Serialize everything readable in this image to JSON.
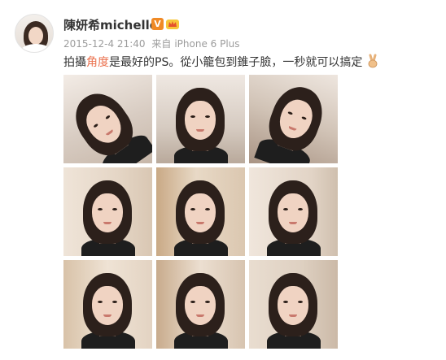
{
  "post": {
    "user_name": "陳妍希michelle",
    "verified_badge": "V",
    "member_badge_icon": "crown-member-icon",
    "timestamp": "2015-12-4 21:40",
    "source_prefix": "来自",
    "source_device": "iPhone 6 Plus",
    "text_before": "拍攝",
    "text_highlight": "角度",
    "text_after": "是最好的PS。從小籠包到錐子臉，一秒就可以搞定",
    "emoji_icon": "victory-hand-icon",
    "highlight_color": "#eb7350",
    "verified_color": "#f08a26"
  },
  "photos": [
    {
      "alt": "selfie-1"
    },
    {
      "alt": "selfie-2"
    },
    {
      "alt": "selfie-3"
    },
    {
      "alt": "selfie-4"
    },
    {
      "alt": "selfie-5"
    },
    {
      "alt": "selfie-6"
    },
    {
      "alt": "selfie-7"
    },
    {
      "alt": "selfie-8"
    },
    {
      "alt": "selfie-9"
    }
  ]
}
